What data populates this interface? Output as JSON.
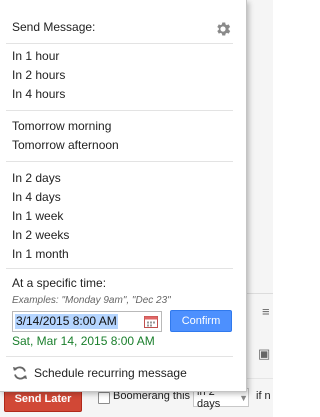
{
  "popup": {
    "title": "Send Message:",
    "gear_icon": "gear-icon",
    "group_hours": [
      "In 1 hour",
      "In 2 hours",
      "In 4 hours"
    ],
    "group_tomorrow": [
      "Tomorrow morning",
      "Tomorrow afternoon"
    ],
    "group_days": [
      "In 2 days",
      "In 4 days",
      "In 1 week",
      "In 2 weeks",
      "In 1 month"
    ],
    "specific": {
      "label": "At a specific time:",
      "examples": "Examples: \"Monday 9am\", \"Dec 23\"",
      "input_value": "3/14/2015 8:00 AM",
      "calendar_icon": "calendar-icon",
      "confirm_label": "Confirm",
      "parsed_value": "Sat, Mar 14, 2015 8:00 AM"
    },
    "recurring": {
      "icon": "recurring-icon",
      "label": "Schedule recurring message"
    }
  },
  "bottom_bar": {
    "send_later_label": "Send Later",
    "boomerang_label": "Boomerang this",
    "days_value": "in 2 days",
    "if_no_text": "if n"
  },
  "colors": {
    "send_later": "#d14836",
    "confirm": "#4d90fe",
    "parsed_text": "#1a7f2c",
    "selection": "#b5d5ff"
  }
}
